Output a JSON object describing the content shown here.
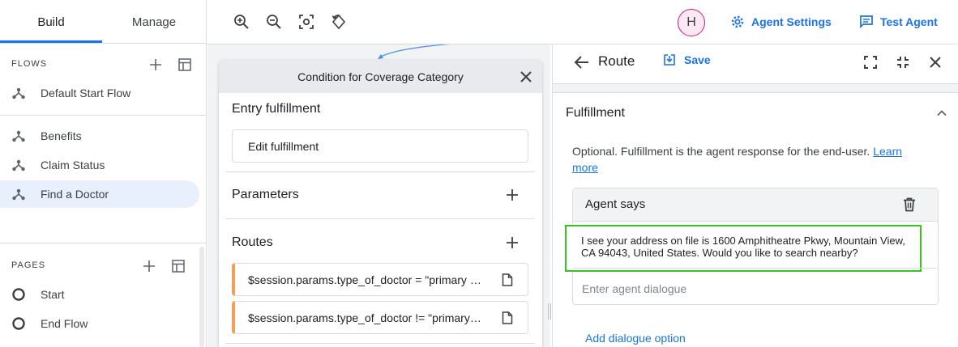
{
  "sidebar": {
    "tabs": [
      {
        "label": "Build"
      },
      {
        "label": "Manage"
      }
    ],
    "flows_label": "FLOWS",
    "flows": [
      {
        "label": "Default Start Flow",
        "icon": "flow-icon"
      },
      {
        "label": "Benefits",
        "icon": "flow-icon"
      },
      {
        "label": "Claim Status",
        "icon": "flow-icon"
      },
      {
        "label": "Find a Doctor",
        "icon": "flow-icon",
        "selected": true
      }
    ],
    "pages_label": "PAGES",
    "pages": [
      {
        "label": "Start",
        "icon": "circle-icon"
      },
      {
        "label": "End Flow",
        "icon": "circle-icon"
      }
    ]
  },
  "toolbar": {
    "tools": [
      "zoom-in-icon",
      "zoom-out-icon",
      "fit-screen-icon",
      "reset-rotate-icon"
    ]
  },
  "node": {
    "title": "Condition for Coverage Category",
    "entry_fulfillment_label": "Entry fulfillment",
    "edit_fulfillment_label": "Edit fulfillment",
    "parameters_label": "Parameters",
    "routes_label": "Routes",
    "routes": [
      {
        "text": "$session.params.type_of_doctor = \"primary care\""
      },
      {
        "text": "$session.params.type_of_doctor != \"primary care\""
      }
    ]
  },
  "header": {
    "avatar_initial": "H",
    "agent_settings_label": "Agent Settings",
    "test_agent_label": "Test Agent"
  },
  "panel": {
    "title": "Route",
    "save_label": "Save",
    "fulfillment_title": "Fulfillment",
    "fulfillment_desc": "Optional. Fulfillment is the agent response for the end-user.",
    "learn_more_label": "Learn more",
    "agent_says_label": "Agent says",
    "agent_message": "I see your address on file is 1600 Amphitheatre Pkwy, Mountain View, CA 94043, United States. Would you like to search nearby?",
    "agent_dialogue_placeholder": "Enter agent dialogue",
    "add_dialogue_label": "Add dialogue option"
  },
  "colors": {
    "accent": "#1a73e8",
    "route_accent": "#f29f57",
    "highlight": "#34c61c",
    "selected_bg": "#e8f0fe",
    "avatar_border": "#d01884"
  }
}
